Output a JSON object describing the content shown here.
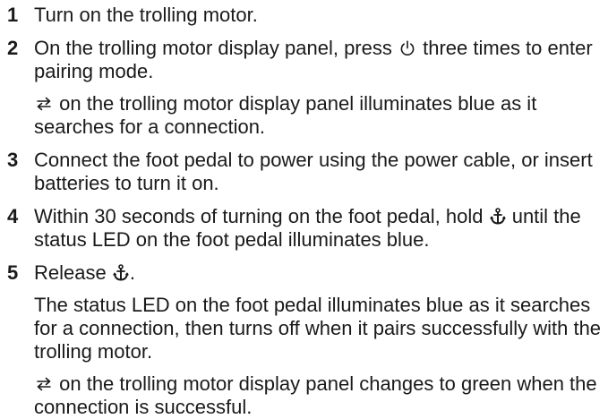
{
  "steps": [
    {
      "number": "1",
      "text": "Turn on the trolling motor."
    },
    {
      "number": "2",
      "text_before_icon": "On the trolling motor display panel, press",
      "icon": "power-icon",
      "text_after_icon": "three times to enter pairing mode.",
      "note": {
        "icon": "pairing-arrows-icon",
        "text": "on the trolling motor display panel illuminates blue as it searches for a connection."
      }
    },
    {
      "number": "3",
      "text": "Connect the foot pedal to power using the power cable, or insert batteries to turn it on."
    },
    {
      "number": "4",
      "text_before_icon": "Within 30 seconds of turning on the foot pedal, hold",
      "icon": "anchor-icon",
      "text_after_icon": "until the status LED on the foot pedal illuminates blue."
    },
    {
      "number": "5",
      "text_before_icon": "Release",
      "icon": "anchor-icon",
      "text_after_icon": ".",
      "notes": [
        {
          "text": "The status LED on the foot pedal illuminates blue as it searches for a connection, then turns off when it pairs successfully with the trolling motor."
        },
        {
          "icon": "pairing-arrows-icon",
          "text": "on the trolling motor display panel changes to green when the connection is successful."
        }
      ]
    }
  ]
}
